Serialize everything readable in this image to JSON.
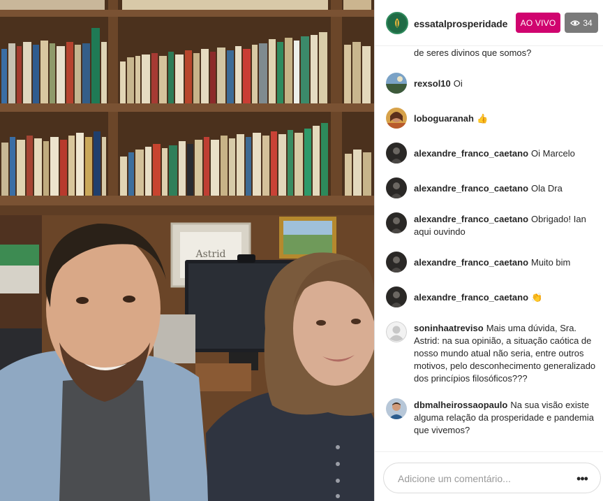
{
  "header": {
    "host_username": "essatalprosperidade",
    "live_label": "AO VIVO",
    "viewer_count": "34"
  },
  "video": {
    "frame_sign": "Astrid"
  },
  "comments": {
    "continued_text": "de seres divinos que somos?",
    "items": [
      {
        "user": "rexsol10",
        "text": "Oi",
        "avatar": "landscape-photo"
      },
      {
        "user": "loboguaranah",
        "text": "👍",
        "avatar": "woman-photo"
      },
      {
        "user": "alexandre_franco_caetano",
        "text": "Oi Marcelo",
        "avatar": "dark-photo"
      },
      {
        "user": "alexandre_franco_caetano",
        "text": "Ola Dra",
        "avatar": "dark-photo"
      },
      {
        "user": "alexandre_franco_caetano",
        "text": "Obrigado! Ian aqui ouvindo",
        "avatar": "dark-photo"
      },
      {
        "user": "alexandre_franco_caetano",
        "text": "Muito bim",
        "avatar": "dark-photo"
      },
      {
        "user": "alexandre_franco_caetano",
        "text": "👏",
        "avatar": "dark-photo"
      },
      {
        "user": "soninhaatreviso",
        "text": "Mais uma dúvida, Sra. Astrid: na sua opinião, a situação caótica de nosso mundo atual não seria, entre outros motivos, pelo desconhecimento generalizado dos princípios filosóficos???",
        "avatar": "default-avatar"
      },
      {
        "user": "dbmalheirossaopaulo",
        "text": "Na sua visão existe alguma relação da prosperidade e pandemia que vivemos?",
        "avatar": "man-photo"
      }
    ]
  },
  "footer": {
    "comment_placeholder": "Adicione um comentário...",
    "more_label": "•••"
  },
  "colors": {
    "live_badge": "#d0046f",
    "viewer_badge": "#7a7a7a",
    "host_avatar": "#1f6b45"
  }
}
